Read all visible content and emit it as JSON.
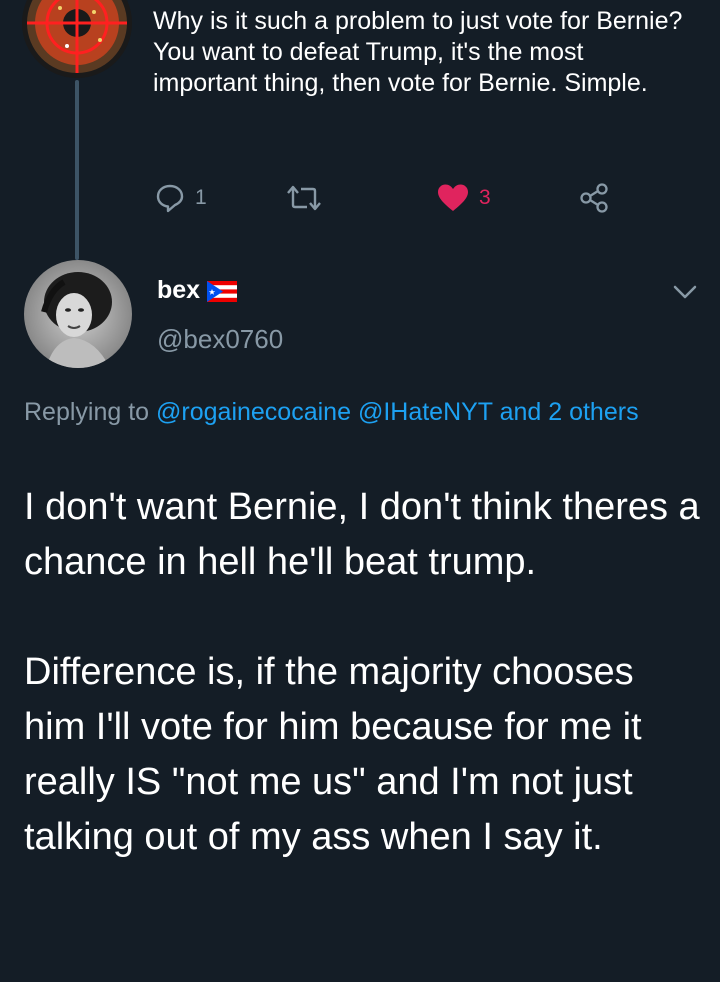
{
  "previous_tweet": {
    "text": "Why is it such a problem to just vote for Bernie? You want to defeat Trump, it's the most important thing, then vote for Bernie. Simple.",
    "actions": {
      "reply_icon": "reply-icon",
      "reply_count": "1",
      "retweet_icon": "retweet-icon",
      "like_icon": "heart-icon",
      "like_count": "3",
      "share_icon": "share-icon"
    },
    "colors": {
      "like": "#e0245e",
      "muted": "#8899a6"
    }
  },
  "reply_tweet": {
    "author": {
      "name": "bex",
      "flag_icon": "puerto-rico-flag-icon",
      "handle": "@bex0760"
    },
    "menu_icon": "chevron-down-icon",
    "replying": {
      "prefix": "Replying to ",
      "user1": "@rogainecocaine",
      "user2": "@IHateNYT",
      "and_others": "and 2 others"
    },
    "paragraph1": "I don't want Bernie, I don't think theres a chance in hell he'll beat trump.",
    "paragraph2": "Difference is, if the majority chooses him I'll vote for him because for me it really IS \"not me us\" and I'm not just talking out of my ass when I say it."
  },
  "theme": {
    "background": "#141d26",
    "link": "#1da1f2",
    "thread_line": "#3d5466"
  }
}
